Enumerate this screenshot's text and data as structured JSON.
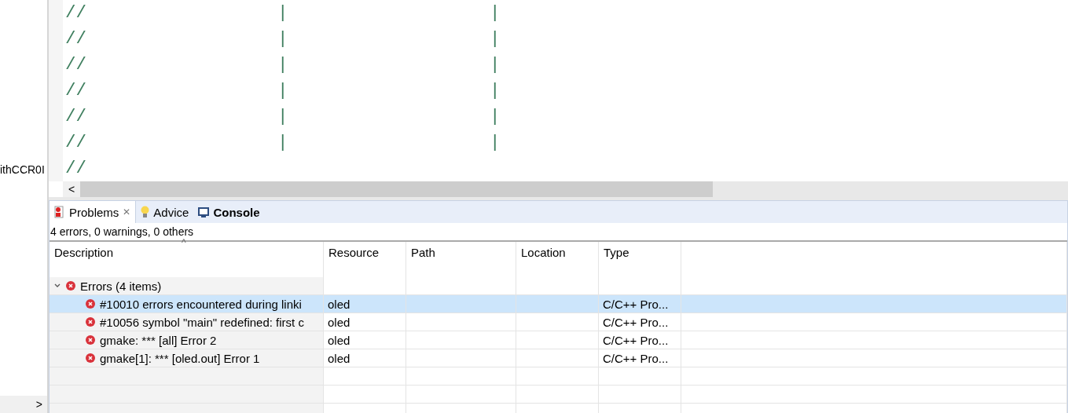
{
  "sidebar": {
    "items": [
      "ithCCR0I"
    ],
    "scroll_arrow": ">"
  },
  "editor": {
    "lines": [
      "//                  |                   |",
      "//                  |                   |",
      "//                  |                   |",
      "//                  |                   |",
      "//                  |                   |",
      "//                  |                   |",
      "//"
    ],
    "scroll_arrow": "<"
  },
  "tabs": [
    {
      "label": "Problems",
      "selected": true,
      "kind": "problems",
      "close_mark": "✕"
    },
    {
      "label": "Advice",
      "selected": false,
      "kind": "advice"
    },
    {
      "label": "Console",
      "selected": false,
      "kind": "console"
    }
  ],
  "summary": "4 errors, 0 warnings, 0 others",
  "table": {
    "sort_mark": "^",
    "columns": [
      "Description",
      "Resource",
      "Path",
      "Location",
      "Type"
    ],
    "group": {
      "label": "Errors (4 items)",
      "expanded": true
    },
    "rows": [
      {
        "description": "#10010 errors encountered during linki",
        "resource": "oled",
        "type": "C/C++ Pro...",
        "selected": true
      },
      {
        "description": "#10056 symbol \"main\" redefined: first c",
        "resource": "oled",
        "type": "C/C++ Pro...",
        "selected": false
      },
      {
        "description": "gmake: *** [all] Error 2",
        "resource": "oled",
        "type": "C/C++ Pro...",
        "selected": false
      },
      {
        "description": "gmake[1]: *** [oled.out] Error 1",
        "resource": "oled",
        "type": "C/C++ Pro...",
        "selected": false
      }
    ]
  }
}
